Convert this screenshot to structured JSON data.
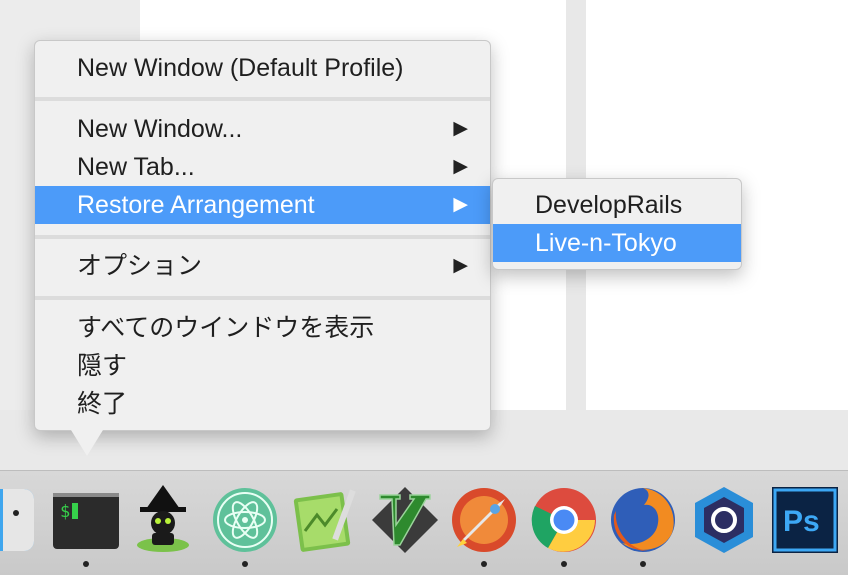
{
  "menu": {
    "items": [
      {
        "label": "New Window (Default Profile)",
        "submenu": false
      },
      {
        "label": "New Window...",
        "submenu": true
      },
      {
        "label": "New Tab...",
        "submenu": true
      },
      {
        "label": "Restore Arrangement",
        "submenu": true,
        "highlighted": true
      },
      {
        "label": "オプション",
        "submenu": true
      },
      {
        "label": "すべてのウインドウを表示",
        "submenu": false
      },
      {
        "label": "隠す",
        "submenu": false
      },
      {
        "label": "終了",
        "submenu": false
      }
    ],
    "arrow_glyph": "▶"
  },
  "submenu": {
    "items": [
      {
        "label": "DevelopRails",
        "highlighted": false
      },
      {
        "label": "Live-n-Tokyo",
        "highlighted": true
      }
    ]
  },
  "dock": {
    "apps": [
      {
        "name": "finder-icon",
        "running": false
      },
      {
        "name": "terminal-icon",
        "running": true,
        "glyph": "$"
      },
      {
        "name": "witch-icon",
        "running": false
      },
      {
        "name": "atom-icon",
        "running": true
      },
      {
        "name": "coda-icon",
        "running": false
      },
      {
        "name": "vim-icon",
        "running": false
      },
      {
        "name": "rocket-icon",
        "running": true
      },
      {
        "name": "chrome-icon",
        "running": true
      },
      {
        "name": "firefox-icon",
        "running": true
      },
      {
        "name": "hexagon-app-icon",
        "running": false
      },
      {
        "name": "photoshop-icon",
        "running": false,
        "glyph": "Ps"
      }
    ]
  },
  "colors": {
    "highlight": "#4c9bf9",
    "menu_bg": "#f0f0f0",
    "dock_bg": "#d8d8d8"
  }
}
